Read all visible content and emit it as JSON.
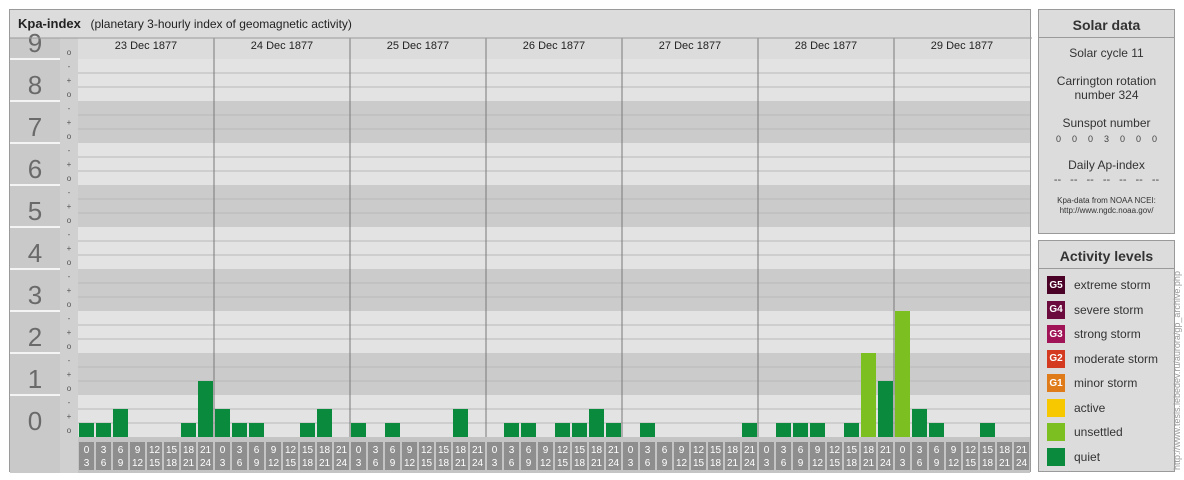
{
  "header": {
    "title": "Kpa-index",
    "subtitle": "(planetary 3-hourly index of geomagnetic activity)"
  },
  "chart_data": {
    "type": "bar",
    "title": "Kpa-index",
    "subtitle": "(planetary 3-hourly index of geomagnetic activity)",
    "ylim": [
      0,
      9
    ],
    "y_ticks": [
      "0",
      "1",
      "2",
      "3",
      "4",
      "5",
      "6",
      "7",
      "8",
      "9"
    ],
    "sub_ticks": [
      "o",
      "+",
      "-"
    ],
    "days": [
      "23 Dec 1877",
      "24 Dec 1877",
      "25 Dec 1877",
      "26 Dec 1877",
      "27 Dec 1877",
      "28 Dec 1877",
      "29 Dec 1877"
    ],
    "interval_labels_top": [
      "0",
      "3",
      "6",
      "9",
      "12",
      "15",
      "18",
      "21"
    ],
    "interval_labels_bottom": [
      "3",
      "6",
      "9",
      "12",
      "15",
      "18",
      "21",
      "24"
    ],
    "series": [
      {
        "values": [
          0.333,
          0.333,
          0.667,
          0,
          0,
          0,
          0.333,
          1.333,
          0.667,
          0.333,
          0.333,
          0,
          0,
          0.333,
          0.667,
          0,
          0.333,
          0,
          0.333,
          0,
          0,
          0,
          0.667,
          0,
          0,
          0.333,
          0.333,
          0,
          0.333,
          0.333,
          0.667,
          0.333,
          0,
          0.333,
          0,
          0,
          0,
          0,
          0,
          0.333,
          0,
          0.333,
          0.333,
          0.333,
          0,
          0.333,
          2,
          1.333,
          3,
          0.667,
          0.333,
          0,
          0,
          0.333,
          0,
          0
        ]
      }
    ],
    "grid": true,
    "colors": {
      "quiet": "#0a8a3c",
      "unsettled": "#7cbf20",
      "active": "#f7c800",
      "minor": "#e07b1a",
      "moderate": "#d43a1f",
      "strong": "#a01457",
      "severe": "#6a0a3d",
      "extreme": "#4a0326"
    }
  },
  "solar": {
    "header": "Solar data",
    "cycle": "Solar cycle 11",
    "carrington_line1": "Carrington rotation",
    "carrington_line2": "number 324",
    "sunspot_label": "Sunspot number",
    "sunspot_values": [
      "0",
      "0",
      "0",
      "3",
      "0",
      "0",
      "0"
    ],
    "ap_label": "Daily Ap-index",
    "ap_values": [
      "--",
      "--",
      "--",
      "--",
      "--",
      "--",
      "--"
    ],
    "source_line1": "Kpa-data from NOAA NCEI:",
    "source_line2": "http://www.ngdc.noaa.gov/"
  },
  "activity": {
    "header": "Activity levels",
    "levels": [
      {
        "badge": "G5",
        "label": "extreme storm",
        "color": "#4a0326"
      },
      {
        "badge": "G4",
        "label": "severe storm",
        "color": "#6a0a3d"
      },
      {
        "badge": "G3",
        "label": "strong storm",
        "color": "#a01457"
      },
      {
        "badge": "G2",
        "label": "moderate storm",
        "color": "#d43a1f"
      },
      {
        "badge": "G1",
        "label": "minor storm",
        "color": "#e07b1a"
      },
      {
        "badge": "",
        "label": "active",
        "color": "#f7c800"
      },
      {
        "badge": "",
        "label": "unsettled",
        "color": "#7cbf20"
      },
      {
        "badge": "",
        "label": "quiet",
        "color": "#0a8a3c"
      }
    ]
  },
  "side_text": "http://www.tesis.lebedev.ru/aurora/gp_archive.php"
}
